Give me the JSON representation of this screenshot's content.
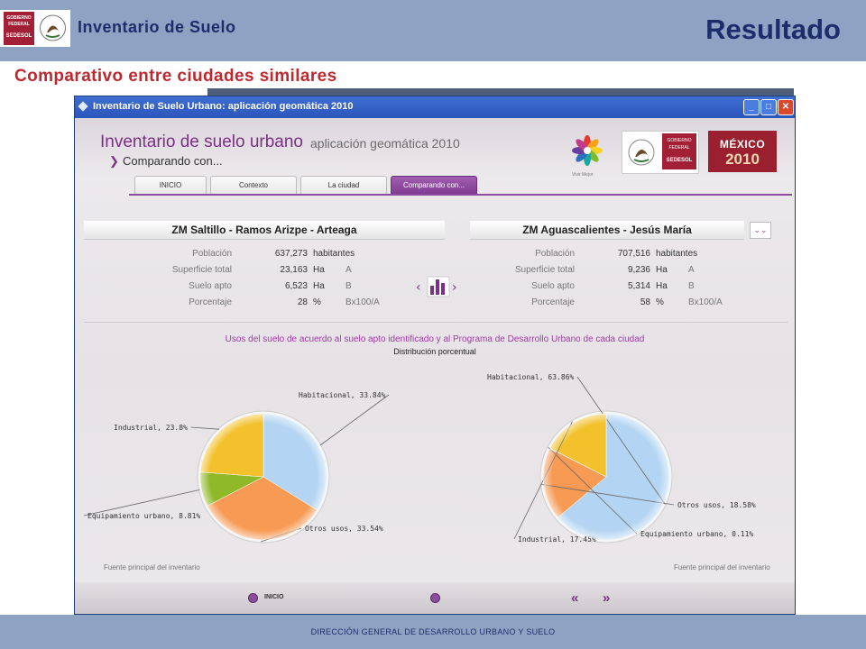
{
  "slide": {
    "logo_lines": [
      "GOBIERNO",
      "FEDERAL",
      "SEDESOL"
    ],
    "subtitle": "Inventario de Suelo",
    "title": "Resultado",
    "heading": "Comparativo entre ciudades similares",
    "footer": "DIRECCIÓN GENERAL DE DESARROLLO URBANO Y SUELO"
  },
  "window": {
    "title": "Inventario de Suelo Urbano: aplicación geomática 2010",
    "controls": {
      "minimize": "_",
      "maximize": "□",
      "close": "✕"
    }
  },
  "app": {
    "title": "Inventario de suelo urbano",
    "title_sub": "aplicación geomática 2010",
    "section": "Comparando con...",
    "logos": {
      "vivir_mejor": "Vivir Mejor",
      "gob": "GOBIERNO FEDERAL",
      "sedesol": "SEDESOL",
      "mexico": "MÉXICO",
      "year": "2010"
    },
    "tabs": [
      {
        "label": "INICIO",
        "active": false
      },
      {
        "label": "Contexto",
        "active": false
      },
      {
        "label": "La ciudad",
        "active": false
      },
      {
        "label": "Comparando con...",
        "active": true
      }
    ],
    "cities": [
      {
        "name": "ZM Saltillo - Ramos Arizpe - Arteaga",
        "stats": [
          {
            "label": "Población",
            "value": "637,273",
            "unit": "habitantes",
            "formula": ""
          },
          {
            "label": "Superficie total",
            "value": "23,163",
            "unit": "Ha",
            "formula": "A"
          },
          {
            "label": "Suelo apto",
            "value": "6,523",
            "unit": "Ha",
            "formula": "B"
          },
          {
            "label": "Porcentaje",
            "value": "28",
            "unit": "%",
            "formula": "Bx100/A"
          }
        ],
        "pie": [
          {
            "label": "Habitacional, 33.84%",
            "value": 33.84,
            "color": "#b3d4f2"
          },
          {
            "label": "Otros usos, 33.54%",
            "value": 33.54,
            "color": "#f79a54"
          },
          {
            "label": "Equipamiento urbano, 8.81%",
            "value": 8.81,
            "color": "#8fb928"
          },
          {
            "label": "Industrial, 23.8%",
            "value": 23.8,
            "color": "#f2c12c"
          }
        ]
      },
      {
        "name": "ZM Aguascalientes - Jesús María",
        "stats": [
          {
            "label": "Población",
            "value": "707,516",
            "unit": "habitantes",
            "formula": ""
          },
          {
            "label": "Superficie total",
            "value": "9,236",
            "unit": "Ha",
            "formula": "A"
          },
          {
            "label": "Suelo apto",
            "value": "5,314",
            "unit": "Ha",
            "formula": "B"
          },
          {
            "label": "Porcentaje",
            "value": "58",
            "unit": "%",
            "formula": "Bx100/A"
          }
        ],
        "pie": [
          {
            "label": "Habitacional, 63.86%",
            "value": 63.86,
            "color": "#b3d4f2"
          },
          {
            "label": "Otros usos, 18.58%",
            "value": 18.58,
            "color": "#f79a54"
          },
          {
            "label": "Equipamiento urbano, 0.11%",
            "value": 0.11,
            "color": "#8fb928"
          },
          {
            "label": "Industrial, 17.45%",
            "value": 17.45,
            "color": "#f2c12c"
          }
        ]
      }
    ],
    "dropdown_icon": "chevron-double-down-icon",
    "chart_title": "Usos del suelo de acuerdo al suelo apto identificado y al Programa de Desarrollo Urbano de cada ciudad",
    "chart_subtitle": "Distribución porcentual",
    "source_label": "Fuente principal del inventario",
    "nav_home": "INICIO"
  },
  "chart_data": [
    {
      "type": "pie",
      "categories": [
        "Habitacional",
        "Otros usos",
        "Equipamiento urbano",
        "Industrial"
      ],
      "values": [
        33.84,
        33.54,
        8.81,
        23.8
      ]
    },
    {
      "type": "pie",
      "categories": [
        "Habitacional",
        "Otros usos",
        "Equipamiento urbano",
        "Industrial"
      ],
      "values": [
        63.86,
        18.58,
        0.11,
        17.45
      ]
    }
  ]
}
